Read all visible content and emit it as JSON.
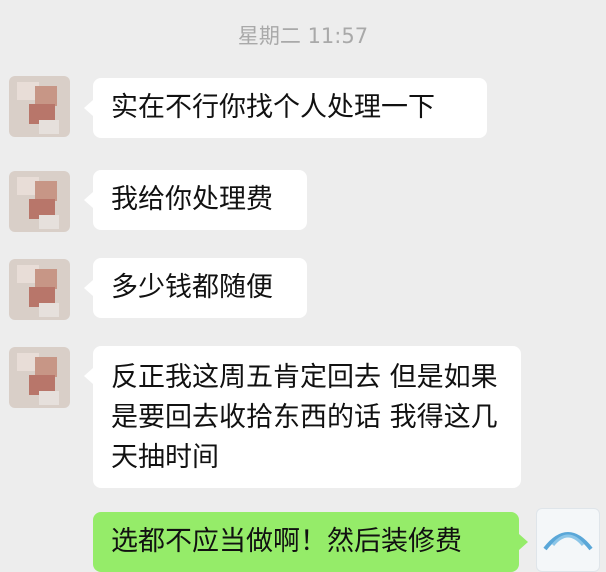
{
  "chat": {
    "timestamp": "星期二 11:57",
    "messages": [
      {
        "sender": "other",
        "text": "实在不行你找个人处理一下"
      },
      {
        "sender": "other",
        "text": "我给你处理费"
      },
      {
        "sender": "other",
        "text": "多少钱都随便"
      },
      {
        "sender": "other",
        "text": "反正我这周五肯定回去 但是如果是要回去收拾东西的话 我得这几天抽时间"
      },
      {
        "sender": "self",
        "text": "选都不应当做啊！然后装修费"
      }
    ]
  },
  "colors": {
    "background": "#ededed",
    "incoming_bubble": "#ffffff",
    "outgoing_bubble": "#95ec69",
    "timestamp_text": "#a9a9a9"
  },
  "icons": {
    "contact_avatar": "pixelated-avatar-icon",
    "self_avatar": "profile-avatar-icon"
  }
}
